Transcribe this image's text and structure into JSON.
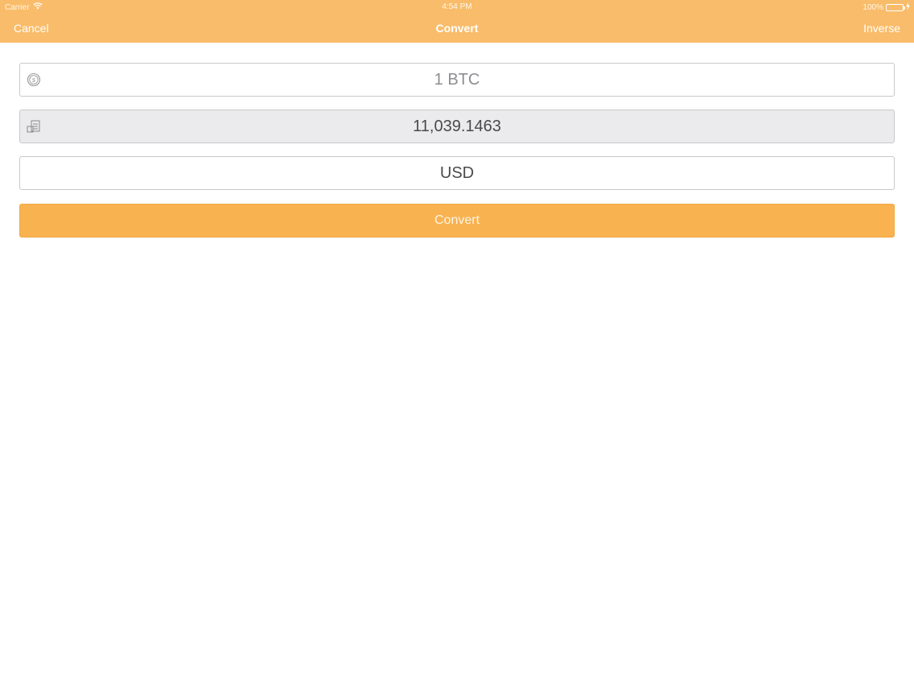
{
  "status_bar": {
    "carrier": "Carrier",
    "time": "4:54 PM",
    "battery": "100%",
    "icons": [
      "wifi-icon",
      "battery-icon",
      "charging-icon"
    ]
  },
  "nav": {
    "left": "Cancel",
    "title": "Convert",
    "right": "Inverse"
  },
  "form": {
    "amount_value": "1 BTC",
    "amount_icon": "bitcoin-coin-icon",
    "result_value": "11,039.1463",
    "result_icon": "money-stack-icon",
    "currency_value": "USD",
    "convert_label": "Convert"
  },
  "colors": {
    "nav_bg": "#f9bc6a",
    "button_bg": "#f8b24f",
    "result_bg": "#ebebed",
    "battery_green": "#4cd964"
  }
}
